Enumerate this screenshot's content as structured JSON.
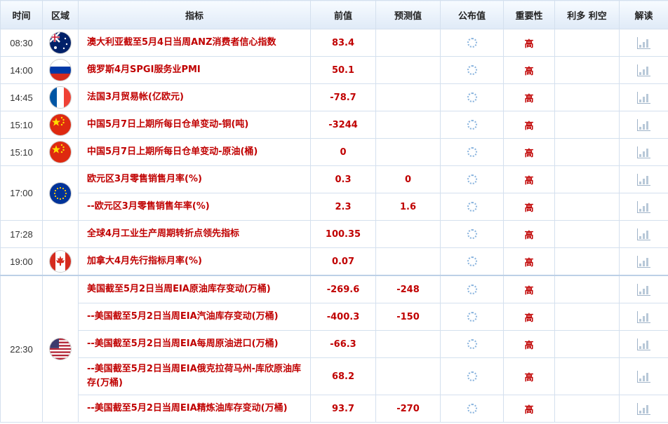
{
  "headers": {
    "time": "时间",
    "region": "区域",
    "indicator": "指标",
    "previous": "前值",
    "forecast": "预测值",
    "actual": "公布值",
    "importance": "重要性",
    "impact": "利多 利空",
    "analysis": "解读"
  },
  "rows": [
    {
      "time": "08:30",
      "flag": "australia-flag-icon",
      "indicator": "澳大利亚截至5月4日当周ANZ消费者信心指数",
      "previous": "83.4",
      "forecast": "",
      "importance": "高"
    },
    {
      "time": "14:00",
      "flag": "russia-flag-icon",
      "indicator": "俄罗斯4月SPGI服务业PMI",
      "previous": "50.1",
      "forecast": "",
      "importance": "高"
    },
    {
      "time": "14:45",
      "flag": "france-flag-icon",
      "indicator": "法国3月贸易帐(亿欧元)",
      "previous": "-78.7",
      "forecast": "",
      "importance": "高"
    },
    {
      "time": "15:10",
      "flag": "china-flag-icon",
      "indicator": "中国5月7日上期所每日仓单变动-铜(吨)",
      "previous": "-3244",
      "forecast": "",
      "importance": "高"
    },
    {
      "time": "15:10",
      "flag": "china-flag-icon",
      "indicator": "中国5月7日上期所每日仓单变动-原油(桶)",
      "previous": "0",
      "forecast": "",
      "importance": "高"
    },
    {
      "time": "17:00",
      "flag": "eu-flag-icon",
      "indicator": "欧元区3月零售销售月率(%)",
      "previous": "0.3",
      "forecast": "0",
      "importance": "高"
    },
    {
      "time": "",
      "flag": "",
      "indicator": "--欧元区3月零售销售年率(%)",
      "previous": "2.3",
      "forecast": "1.6",
      "importance": "高"
    },
    {
      "time": "17:28",
      "flag": "",
      "indicator": "全球4月工业生产周期转折点领先指标",
      "previous": "100.35",
      "forecast": "",
      "importance": "高"
    },
    {
      "time": "19:00",
      "flag": "canada-flag-icon",
      "indicator": "加拿大4月先行指标月率(%)",
      "previous": "0.07",
      "forecast": "",
      "importance": "高"
    },
    {
      "time": "22:30",
      "flag": "usa-flag-icon",
      "indicator": "美国截至5月2日当周EIA原油库存变动(万桶)",
      "previous": "-269.6",
      "forecast": "-248",
      "importance": "高"
    },
    {
      "time": "",
      "flag": "",
      "indicator": "--美国截至5月2日当周EIA汽油库存变动(万桶)",
      "previous": "-400.3",
      "forecast": "-150",
      "importance": "高"
    },
    {
      "time": "",
      "flag": "",
      "indicator": "--美国截至5月2日当周EIA每周原油进口(万桶)",
      "previous": "-66.3",
      "forecast": "",
      "importance": "高"
    },
    {
      "time": "",
      "flag": "",
      "indicator": "--美国截至5月2日当周EIA俄克拉荷马州-库欣原油库存(万桶)",
      "previous": "68.2",
      "forecast": "",
      "importance": "高"
    },
    {
      "time": "",
      "flag": "",
      "indicator": "--美国截至5月2日当周EIA精炼油库存变动(万桶)",
      "previous": "93.7",
      "forecast": "-270",
      "importance": "高"
    }
  ]
}
